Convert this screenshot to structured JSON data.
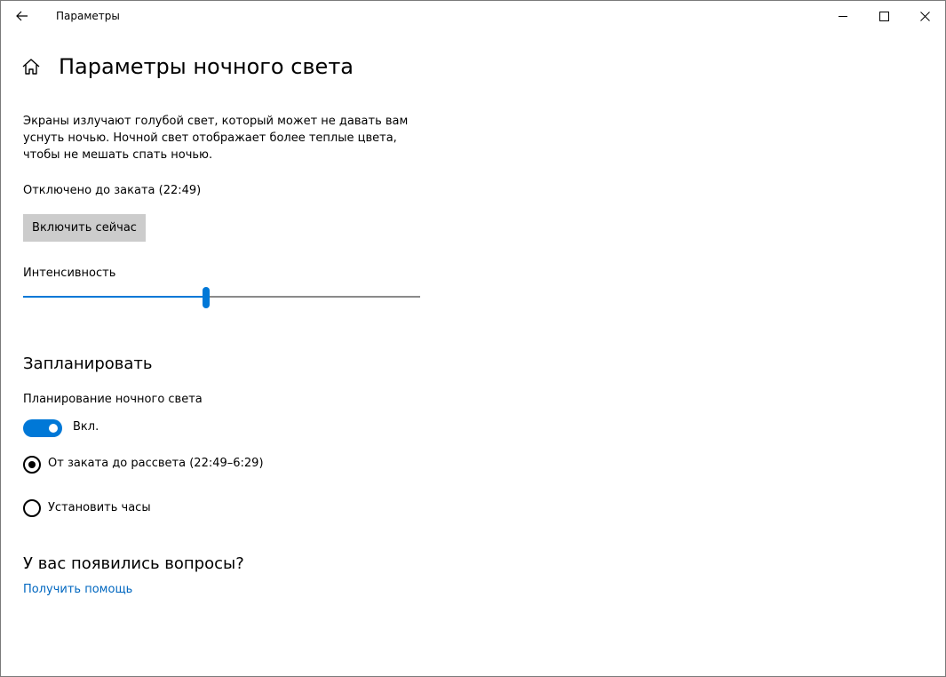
{
  "window": {
    "app_title": "Параметры"
  },
  "header": {
    "title": "Параметры ночного света"
  },
  "description": "Экраны излучают голубой свет, который может не давать вам уснуть ночью. Ночной свет отображает более теплые цвета, чтобы не мешать спать ночью.",
  "status_text": "Отключено до заката (22:49)",
  "enable_button_label": "Включить сейчас",
  "intensity": {
    "label": "Интенсивность",
    "value_fraction": 0.46
  },
  "schedule": {
    "section_title": "Запланировать",
    "toggle_label": "Планирование ночного света",
    "toggle_state_text": "Вкл.",
    "toggle_on": true,
    "options": [
      {
        "label": "От заката до рассвета (22:49–6:29)",
        "selected": true
      },
      {
        "label": "Установить часы",
        "selected": false
      }
    ]
  },
  "help": {
    "title": "У вас появились вопросы?",
    "link_label": "Получить помощь"
  },
  "colors": {
    "accent": "#0078d7",
    "link": "#0067c0",
    "button_bg": "#cccccc",
    "track": "#8a8a8a"
  },
  "icons": {
    "back": "back-arrow-icon",
    "home": "home-icon",
    "minimize": "minimize-icon",
    "maximize": "maximize-icon",
    "close": "close-icon"
  }
}
